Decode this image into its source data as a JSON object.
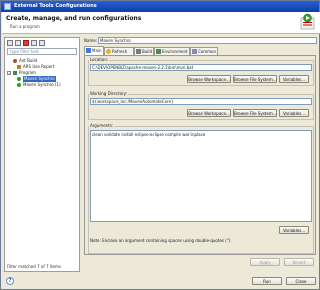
{
  "window": {
    "title": "External Tools Configurations"
  },
  "header": {
    "title": "Create, manage, and run configurations",
    "subtitle": "Run a program"
  },
  "left": {
    "filter_placeholder": "type filter text",
    "tree": [
      {
        "label": "Ant Build",
        "icon": "ant-icon"
      },
      {
        "label": "ARS Use Report",
        "icon": "ant-file-icon"
      },
      {
        "label": "Program",
        "icon": "program-icon"
      },
      {
        "label": "Maven Synchro",
        "icon": "program-run-icon"
      },
      {
        "label": "Maven Synchro (1)",
        "icon": "program-run-icon"
      }
    ],
    "status": "Filter matched 7 of 7 items"
  },
  "right": {
    "name_label": "Name:",
    "name_value": "Maven Synchro",
    "tabs": [
      {
        "label": "Main"
      },
      {
        "label": "Refresh"
      },
      {
        "label": "Build"
      },
      {
        "label": "Environment"
      },
      {
        "label": "Common"
      }
    ],
    "location": {
      "label": "Location:",
      "value": "C:\\DEV\\OPENBIZ\\apache-maven-2.2.1\\bin\\mvn.bat",
      "buttons": [
        "Browse Workspace...",
        "Browse File System...",
        "Variables..."
      ]
    },
    "workdir": {
      "label": "Working Directory:",
      "value": "${workspace_loc:/MavenAutomateCore}",
      "buttons": [
        "Browse Workspace...",
        "Browse File System...",
        "Variables..."
      ]
    },
    "arguments": {
      "label": "Arguments:",
      "value": "clean validate install eclipse:eclipse compile war:inplace",
      "variables_button": "Variables...",
      "note": "Note: Enclose an argument containing spaces using double-quotes (\")."
    },
    "apply_label": "Apply",
    "revert_label": "Revert"
  },
  "footer": {
    "run_label": "Run",
    "close_label": "Close"
  }
}
